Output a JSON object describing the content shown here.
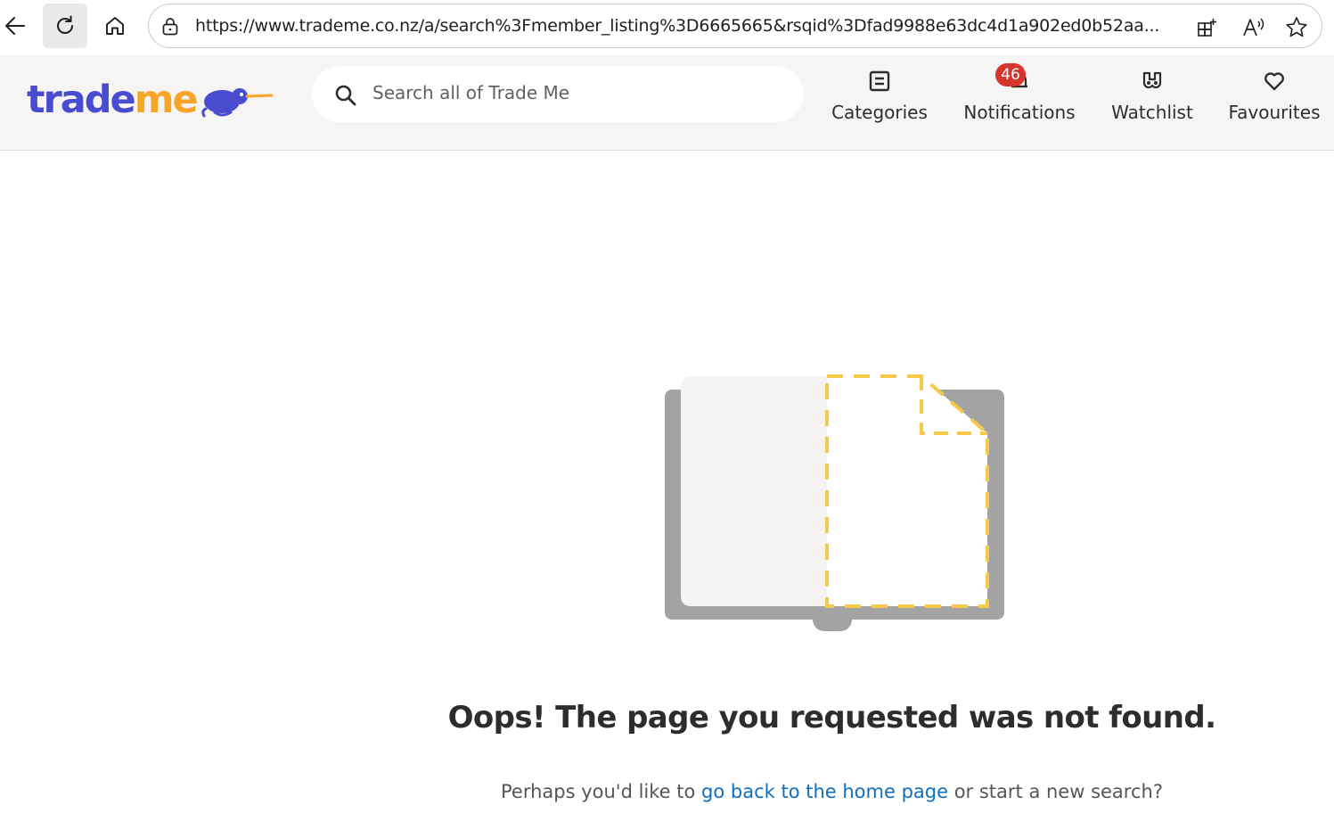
{
  "browser": {
    "url": "https://www.trademe.co.nz/a/search%3Fmember_listing%3D6665665&rsqid%3Dfad9988e63dc4d1a902ed0b52aa..."
  },
  "header": {
    "logo": {
      "trade": "trade",
      "me": "me"
    },
    "search": {
      "placeholder": "Search all of Trade Me"
    },
    "nav": {
      "categories": "Categories",
      "notifications": "Notifications",
      "notifications_count": "46",
      "watchlist": "Watchlist",
      "favourites": "Favourites"
    }
  },
  "main": {
    "heading": "Oops! The page you requested was not found.",
    "message_before": "Perhaps you'd like to ",
    "home_link": "go back to the home page",
    "message_after": " or start a new search?"
  },
  "colors": {
    "brand_blue": "#4a4cd0",
    "brand_yellow": "#f6a526",
    "link": "#0f6fbf",
    "badge": "#d7352b",
    "header_bg": "#f6f5f4"
  },
  "icons": [
    "back-arrow-icon",
    "reload-icon",
    "home-icon",
    "lock-icon",
    "apps-icon",
    "read-aloud-icon",
    "favorite-star-icon",
    "search-icon",
    "categories-icon",
    "bell-icon",
    "watchlist-binoculars-icon",
    "heart-icon",
    "kiwi-icon"
  ]
}
